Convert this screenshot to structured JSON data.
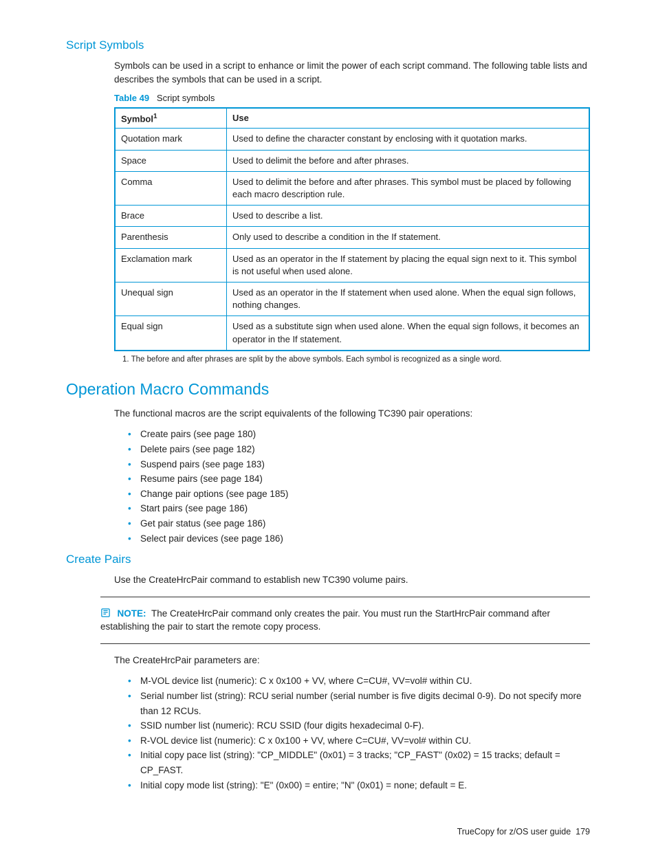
{
  "section1": {
    "heading": "Script Symbols",
    "intro": "Symbols can be used in a script to enhance or limit the power of each script command. The following table lists and describes the symbols that can be used in a script.",
    "table_caption_label": "Table 49",
    "table_caption_text": "Script symbols",
    "col1_header": "Symbol",
    "col1_sup": "1",
    "col2_header": "Use",
    "rows": [
      {
        "sym": "Quotation mark",
        "use": "Used to define the character constant by enclosing with it quotation marks."
      },
      {
        "sym": "Space",
        "use": "Used to delimit the before and after phrases."
      },
      {
        "sym": "Comma",
        "use": "Used to delimit the before and after phrases. This symbol must be placed by following each macro description rule."
      },
      {
        "sym": "Brace",
        "use": "Used to describe a list."
      },
      {
        "sym": "Parenthesis",
        "use": "Only used to describe a condition in the If statement."
      },
      {
        "sym": "Exclamation mark",
        "use": "Used as an operator in the If statement by placing the equal sign next to it. This symbol is not useful when used alone."
      },
      {
        "sym": "Unequal sign",
        "use": "Used as an operator in the If statement when used alone. When the equal sign follows, nothing changes."
      },
      {
        "sym": "Equal sign",
        "use": "Used as a substitute sign when used alone. When the equal sign follows, it becomes an operator in the If statement."
      }
    ],
    "footnote": "1. The before and after phrases are split by the above symbols. Each symbol is recognized as a single word."
  },
  "section2": {
    "heading": "Operation Macro Commands",
    "intro": "The functional macros are the script equivalents of the following TC390 pair operations:",
    "items": [
      "Create pairs (see page 180)",
      "Delete pairs (see page 182)",
      "Suspend pairs (see page 183)",
      "Resume pairs (see page 184)",
      "Change pair options (see page 185)",
      "Start pairs (see page 186)",
      "Get pair status (see page 186)",
      "Select pair devices (see page 186)"
    ]
  },
  "section3": {
    "heading": "Create Pairs",
    "intro": "Use the CreateHrcPair command to establish new TC390 volume pairs.",
    "note_label": "NOTE:",
    "note_text": "The CreateHrcPair command only creates the pair. You must run the StartHrcPair command after establishing the pair to start the remote copy process.",
    "param_intro": "The CreateHrcPair parameters are:",
    "params": [
      "M-VOL device list (numeric): C x 0x100 + VV, where C=CU#, VV=vol# within CU.",
      "Serial number list (string): RCU serial number (serial number is five digits decimal 0-9). Do not specify more than 12 RCUs.",
      "SSID number list (numeric): RCU SSID (four digits hexadecimal 0-F).",
      "R-VOL device list (numeric): C x 0x100 + VV, where C=CU#, VV=vol# within CU.",
      "Initial copy pace list (string): \"CP_MIDDLE\" (0x01) = 3 tracks; \"CP_FAST\" (0x02) = 15 tracks; default = CP_FAST.",
      "Initial copy mode list (string): \"E\" (0x00) = entire; \"N\" (0x01) = none; default = E."
    ]
  },
  "footer": {
    "title": "TrueCopy for z/OS user guide",
    "page": "179"
  },
  "chart_data": {
    "type": "table",
    "title": "Table 49 Script symbols",
    "columns": [
      "Symbol",
      "Use"
    ],
    "rows": [
      [
        "Quotation mark",
        "Used to define the character constant by enclosing with it quotation marks."
      ],
      [
        "Space",
        "Used to delimit the before and after phrases."
      ],
      [
        "Comma",
        "Used to delimit the before and after phrases. This symbol must be placed by following each macro description rule."
      ],
      [
        "Brace",
        "Used to describe a list."
      ],
      [
        "Parenthesis",
        "Only used to describe a condition in the If statement."
      ],
      [
        "Exclamation mark",
        "Used as an operator in the If statement by placing the equal sign next to it. This symbol is not useful when used alone."
      ],
      [
        "Unequal sign",
        "Used as an operator in the If statement when used alone. When the equal sign follows, nothing changes."
      ],
      [
        "Equal sign",
        "Used as a substitute sign when used alone. When the equal sign follows, it becomes an operator in the If statement."
      ]
    ]
  }
}
